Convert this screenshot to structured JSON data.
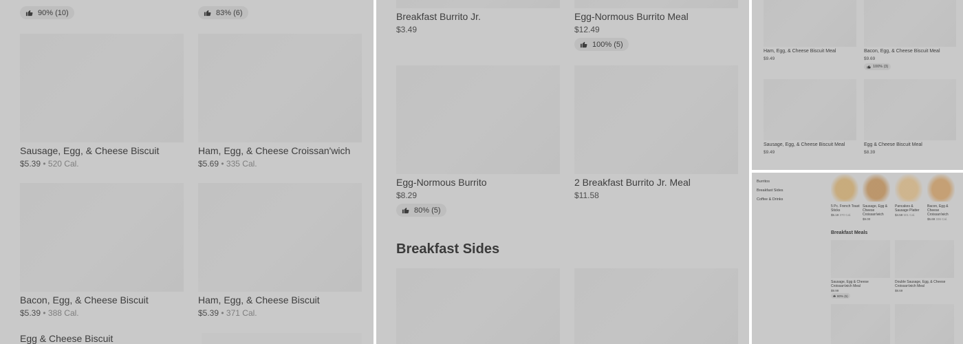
{
  "panel1": {
    "top_ratings": [
      {
        "text": "90% (10)"
      },
      {
        "text": "83% (6)"
      }
    ],
    "items": [
      {
        "title": "Sausage, Egg, & Cheese Biscuit",
        "price": "$5.39",
        "cal": "520 Cal."
      },
      {
        "title": "Ham, Egg, & Cheese Croissan'wich",
        "price": "$5.69",
        "cal": "335 Cal."
      },
      {
        "title": "Bacon, Egg, & Cheese Biscuit",
        "price": "$5.39",
        "cal": "388 Cal."
      },
      {
        "title": "Ham, Egg, & Cheese Biscuit",
        "price": "$5.39",
        "cal": "371 Cal."
      },
      {
        "title": "Egg & Cheese Biscuit"
      }
    ],
    "separator": "•"
  },
  "panel2": {
    "items": [
      {
        "title": "Breakfast Burrito Jr.",
        "price": "$3.49"
      },
      {
        "title": "Egg-Normous Burrito Meal",
        "price": "$12.49",
        "rating": "100% (5)"
      },
      {
        "title": "Egg-Normous Burrito",
        "price": "$8.29",
        "rating": "80% (5)"
      },
      {
        "title": "2 Breakfast Burrito Jr. Meal",
        "price": "$11.58"
      }
    ],
    "section_heading": "Breakfast Sides"
  },
  "panel3": {
    "items": [
      {
        "title": "Ham, Egg, & Cheese Biscuit Meal",
        "price": "$9.49"
      },
      {
        "title": "Bacon, Egg, & Cheese Biscuit Meal",
        "price": "$9.69",
        "rating": "100% (3)"
      },
      {
        "title": "Sausage, Egg, & Cheese Biscuit Meal",
        "price": "$9.49"
      },
      {
        "title": "Egg & Cheese Biscuit Meal",
        "price": "$8.39"
      }
    ]
  },
  "panel4": {
    "sidebar": [
      "Burritos",
      "Breakfast Sides",
      "Coffee & Drinks"
    ],
    "row_items": [
      {
        "title": "5 Pc. French Toast Sticks",
        "price": "$5.19",
        "cal": "370 Cal."
      },
      {
        "title": "Sausage, Egg & Cheese Croissan'wich",
        "price": "$9.00"
      },
      {
        "title": "Pancakes & Sausage Platter",
        "price": "$4.59",
        "cal": "501 Cal."
      },
      {
        "title": "Bacon, Egg & Cheese Croissan'wich",
        "price": "$5.69",
        "cal": "336 Cal."
      }
    ],
    "section_heading": "Breakfast Meals",
    "meal_items": [
      {
        "title": "Sausage, Egg & Cheese Croissan'wich Meal",
        "price": "$9.99",
        "rating": "80% (5)"
      },
      {
        "title": "Double Sausage, Egg, & Cheese Croissan'wich Meal",
        "price": "$8.69"
      }
    ],
    "food_colors": [
      "#c8a46a",
      "#b88a55",
      "#d0b080",
      "#c49660"
    ]
  }
}
